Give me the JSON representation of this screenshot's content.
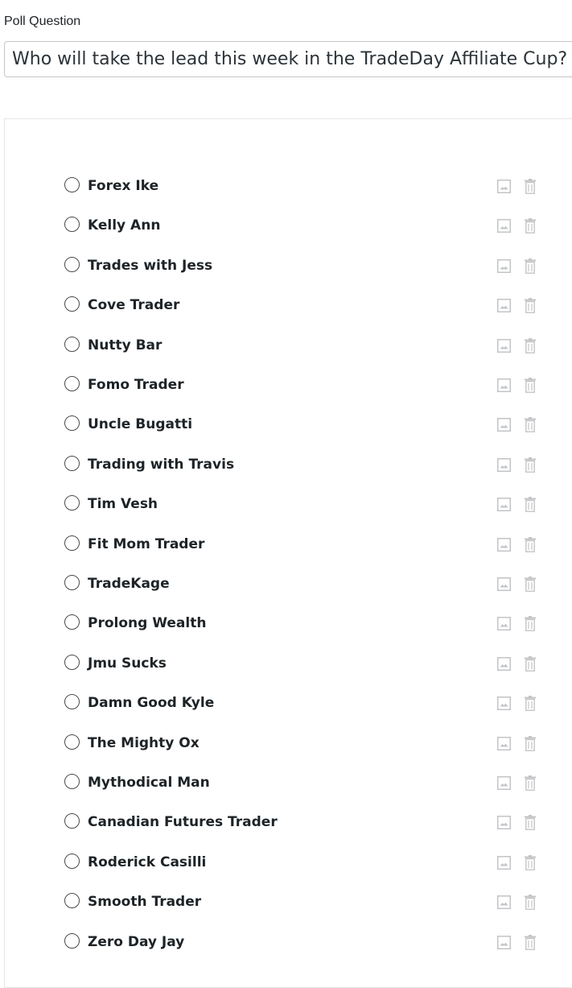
{
  "poll": {
    "question_label": "Poll Question",
    "question_value": "Who will take the lead this week in the TradeDay Affiliate Cup?"
  },
  "options": [
    {
      "label": "Forex Ike"
    },
    {
      "label": "Kelly Ann"
    },
    {
      "label": "Trades with Jess"
    },
    {
      "label": "Cove Trader"
    },
    {
      "label": "Nutty Bar"
    },
    {
      "label": "Fomo Trader"
    },
    {
      "label": "Uncle Bugatti"
    },
    {
      "label": "Trading with Travis"
    },
    {
      "label": "Tim Vesh"
    },
    {
      "label": "Fit Mom Trader"
    },
    {
      "label": "TradeKage"
    },
    {
      "label": "Prolong Wealth"
    },
    {
      "label": "Jmu Sucks"
    },
    {
      "label": "Damn Good Kyle"
    },
    {
      "label": "The Mighty Ox"
    },
    {
      "label": "Mythodical Man"
    },
    {
      "label": "Canadian Futures Trader"
    },
    {
      "label": "Roderick Casilli"
    },
    {
      "label": "Smooth Trader"
    },
    {
      "label": "Zero Day Jay"
    }
  ],
  "icons": {
    "radio": "radio-button-icon",
    "image": "image-icon",
    "delete": "trash-icon"
  },
  "colors": {
    "icon_gray": "#c3c4c7",
    "border": "#c3c4c7",
    "text": "#1d2327"
  }
}
